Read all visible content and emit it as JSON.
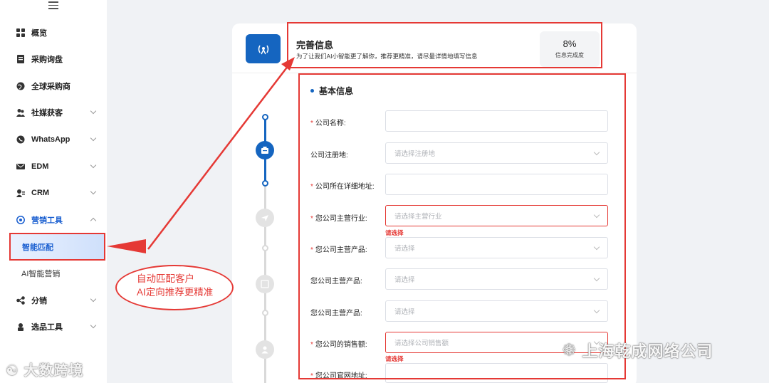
{
  "sidebar": {
    "items": [
      {
        "label": "概览",
        "icon": "grid-icon"
      },
      {
        "label": "采购询盘",
        "icon": "document-icon"
      },
      {
        "label": "全球采购商",
        "icon": "globe-icon"
      },
      {
        "label": "社媒获客",
        "icon": "users-icon"
      },
      {
        "label": "WhatsApp",
        "icon": "whatsapp-icon"
      },
      {
        "label": "EDM",
        "icon": "mail-icon"
      },
      {
        "label": "CRM",
        "icon": "contacts-icon"
      },
      {
        "label": "营销工具",
        "icon": "target-icon"
      },
      {
        "label": "分销",
        "icon": "share-icon"
      },
      {
        "label": "选品工具",
        "icon": "product-icon"
      }
    ],
    "sub_items": [
      {
        "label": "智能匹配"
      },
      {
        "label": "AI智能营销"
      }
    ]
  },
  "header": {
    "title": "完善信息",
    "description": "为了让我们AI小智能更了解你，推荐更精准，请尽量详情地填写信息",
    "progress_value": "8%",
    "progress_label": "信息完成度"
  },
  "form": {
    "section_title": "基本信息",
    "fields": [
      {
        "label": "公司名称:",
        "required": true,
        "placeholder": ""
      },
      {
        "label": "公司注册地:",
        "required": false,
        "placeholder": "请选择注册地"
      },
      {
        "label": "公司所在详细地址:",
        "required": true,
        "placeholder": ""
      },
      {
        "label": "您公司主营行业:",
        "required": true,
        "placeholder": "请选择主营行业",
        "error": "请选择"
      },
      {
        "label": "您公司主营产品:",
        "required": true,
        "placeholder": "请选择"
      },
      {
        "label": "您公司主营产品:",
        "required": false,
        "placeholder": "请选择"
      },
      {
        "label": "您公司主营产品:",
        "required": false,
        "placeholder": "请选择"
      },
      {
        "label": "您公司的销售额:",
        "required": true,
        "placeholder": "请选择公司销售额",
        "error": "请选择"
      },
      {
        "label": "您公司官网地址:",
        "required": true,
        "placeholder": ""
      }
    ]
  },
  "annotation": {
    "line1": "自动匹配客户",
    "line2": "AI定向推荐更精准"
  },
  "watermarks": {
    "left": "大数跨境",
    "right": "上海乾成网络公司"
  },
  "colors": {
    "accent": "#1565c0",
    "highlight": "#e53935"
  }
}
